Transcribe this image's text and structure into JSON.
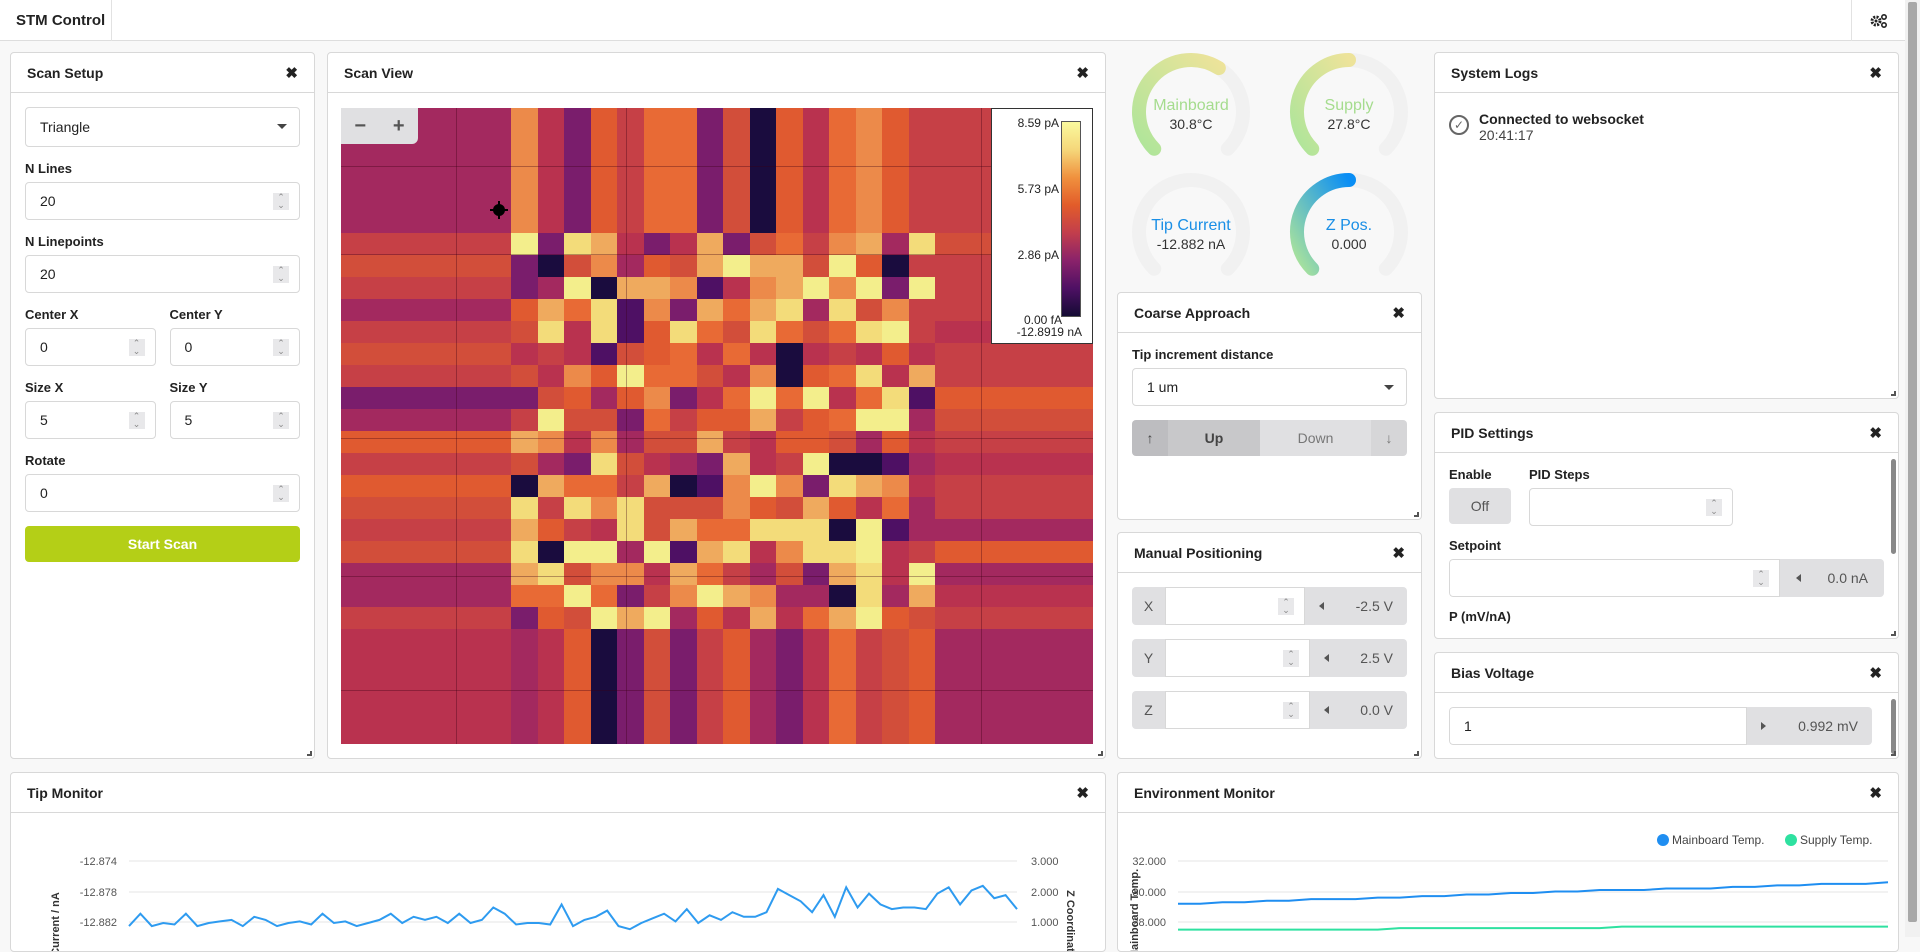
{
  "app": {
    "title": "STM Control",
    "settings_icon": "gears-icon"
  },
  "scan_setup": {
    "title": "Scan Setup",
    "mode": "Triangle",
    "n_lines_label": "N Lines",
    "n_lines": "20",
    "n_linepoints_label": "N Linepoints",
    "n_linepoints": "20",
    "center_x_label": "Center X",
    "center_x": "0",
    "center_y_label": "Center Y",
    "center_y": "0",
    "size_x_label": "Size X",
    "size_x": "5",
    "size_y_label": "Size Y",
    "size_y": "5",
    "rotate_label": "Rotate",
    "rotate": "0",
    "start_label": "Start Scan",
    "start_color": "#b4cf17"
  },
  "scan_view": {
    "title": "Scan View",
    "zoom_out": "−",
    "zoom_in": "+",
    "colorbar": {
      "ticks": [
        "8.59 pA",
        "5.73 pA",
        "2.86 pA",
        "0.00 fA"
      ],
      "offset": "-12.8919 nA",
      "colormap": "inferno"
    }
  },
  "gauges": [
    {
      "label": "Mainboard",
      "value": "30.8°C",
      "fill": 0.62,
      "label_color": "#a5dc8e"
    },
    {
      "label": "Supply",
      "value": "27.8°C",
      "fill": 0.5,
      "label_color": "#a5dc8e"
    },
    {
      "label": "Tip Current",
      "value": "-12.882 nA",
      "fill": 0,
      "label_color": "#1a8fe6"
    },
    {
      "label": "Z Pos.",
      "value": "0.000",
      "fill": 0.5,
      "label_color": "#1a8fe6"
    }
  ],
  "coarse_approach": {
    "title": "Coarse Approach",
    "increment_label": "Tip increment distance",
    "increment": "1 um",
    "up_label": "Up",
    "down_label": "Down"
  },
  "manual_positioning": {
    "title": "Manual Positioning",
    "rows": [
      {
        "axis": "X",
        "value": "-2.5 V"
      },
      {
        "axis": "Y",
        "value": "2.5 V"
      },
      {
        "axis": "Z",
        "value": "0.0 V"
      }
    ]
  },
  "system_logs": {
    "title": "System Logs",
    "entries": [
      {
        "message": "Connected to websocket",
        "time": "20:41:17"
      }
    ]
  },
  "pid_settings": {
    "title": "PID Settings",
    "enable_label": "Enable",
    "enable_state": "Off",
    "steps_label": "PID Steps",
    "steps_value": "",
    "setpoint_label": "Setpoint",
    "setpoint_readout": "0.0 nA",
    "p_label": "P (mV/nA)"
  },
  "bias_voltage": {
    "title": "Bias Voltage",
    "value": "1",
    "readout": "0.992 mV"
  },
  "tip_monitor": {
    "title": "Tip Monitor"
  },
  "environment_monitor": {
    "title": "Environment Monitor"
  },
  "chart_data": [
    {
      "type": "line",
      "title": "Tip Monitor",
      "ylabel": "Current / nA",
      "y2label": "Z Coordinate",
      "yticks": [
        "-12.874",
        "-12.878",
        "-12.882"
      ],
      "y2ticks": [
        "3.000",
        "2.000",
        "1.000"
      ],
      "ylim": [
        -12.886,
        -12.874
      ],
      "y2lim": [
        1.0,
        3.0
      ],
      "series": [
        {
          "name": "Z Coordinate",
          "axis": "y2",
          "color": "#2e9bf0",
          "values": [
            0.9,
            1.3,
            0.9,
            1.0,
            0.95,
            1.3,
            0.9,
            1.0,
            1.05,
            1.1,
            0.9,
            1.2,
            1.1,
            0.9,
            1.0,
            1.05,
            0.95,
            1.3,
            1.0,
            1.05,
            0.9,
            1.0,
            1.1,
            1.3,
            1.0,
            1.2,
            1.1,
            1.2,
            1.0,
            1.3,
            1.0,
            1.1,
            1.5,
            1.3,
            0.95,
            1.0,
            1.0,
            0.95,
            1.6,
            0.9,
            1.1,
            1.2,
            1.4,
            0.9,
            0.8,
            1.0,
            1.15,
            1.3,
            1.05,
            1.45,
            1.0,
            1.25,
            1.1,
            1.35,
            1.2,
            1.2,
            1.35,
            2.1,
            1.9,
            1.7,
            1.35,
            1.9,
            1.2,
            2.15,
            1.5,
            1.95,
            1.6,
            1.45,
            1.5,
            1.5,
            1.45,
            1.95,
            2.15,
            1.6,
            2.05,
            2.2,
            1.8,
            1.9,
            1.45
          ]
        }
      ]
    },
    {
      "type": "line",
      "title": "Environment Monitor",
      "ylabel": "Mainboard Temp.",
      "yticks": [
        "32.000",
        "30.000",
        "28.000"
      ],
      "ylim": [
        26.0,
        32.0
      ],
      "legend": "top-right",
      "series": [
        {
          "name": "Mainboard Temp.",
          "color": "#1f8ef1",
          "values": [
            29.2,
            29.2,
            29.3,
            29.3,
            29.4,
            29.4,
            29.5,
            29.5,
            29.5,
            29.6,
            29.6,
            29.7,
            29.7,
            29.8,
            29.8,
            29.9,
            29.9,
            30.0,
            30.0,
            30.1,
            30.1,
            30.1,
            30.2,
            30.2,
            30.2,
            30.3,
            30.3,
            30.4,
            30.4,
            30.5,
            30.5,
            30.5,
            30.6
          ]
        },
        {
          "name": "Supply Temp.",
          "color": "#2ee1a0",
          "values": [
            27.5,
            27.5,
            27.5,
            27.5,
            27.5,
            27.5,
            27.5,
            27.5,
            27.5,
            27.5,
            27.6,
            27.6,
            27.6,
            27.6,
            27.6,
            27.6,
            27.6,
            27.6,
            27.6,
            27.6,
            27.7,
            27.7,
            27.7,
            27.7,
            27.7,
            27.7,
            27.7,
            27.7,
            27.7,
            27.7,
            27.7,
            27.7,
            27.7
          ]
        }
      ]
    }
  ]
}
